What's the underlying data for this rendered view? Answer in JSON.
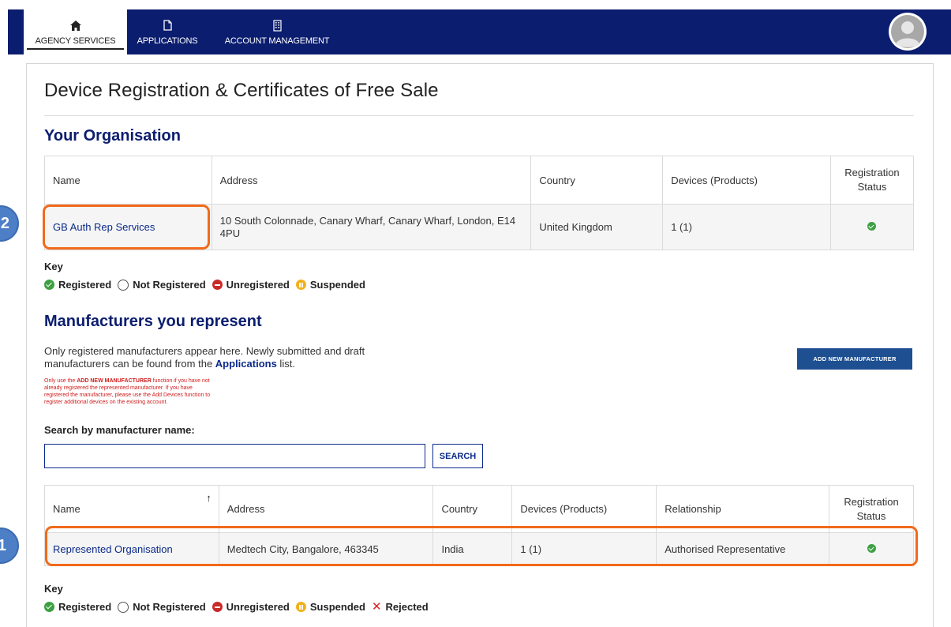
{
  "nav": {
    "tabs": [
      {
        "label": "AGENCY SERVICES",
        "icon": "home-icon",
        "active": true
      },
      {
        "label": "APPLICATIONS",
        "icon": "document-icon",
        "active": false
      },
      {
        "label": "ACCOUNT MANAGEMENT",
        "icon": "building-icon",
        "active": false
      }
    ]
  },
  "page_title": "Device Registration & Certificates of Free Sale",
  "your_org": {
    "heading": "Your Organisation",
    "columns": [
      "Name",
      "Address",
      "Country",
      "Devices (Products)",
      "Registration Status"
    ],
    "row": {
      "name": "GB Auth Rep Services",
      "address": "10 South Colonnade, Canary Wharf, Canary Wharf, London, E14 4PU",
      "country": "United Kingdom",
      "devices": "1 (1)",
      "status": "registered"
    }
  },
  "key1": {
    "title": "Key",
    "items": [
      "Registered",
      "Not Registered",
      "Unregistered",
      "Suspended"
    ]
  },
  "manufacturers": {
    "heading": "Manufacturers you represent",
    "intro_line1": "Only registered manufacturers appear here. Newly submitted and draft",
    "intro_line2_pre": "manufacturers can be found from the ",
    "intro_link": "Applications",
    "intro_line2_post": " list.",
    "warn_pre": "Only use the ",
    "warn_bold": "ADD NEW MANUFACTURER",
    "warn_post1": " function if you have not",
    "warn_line2": "already registered the represented manufacturer. If you have",
    "warn_line3": "registered the manufacturer, please use the Add Devices function to",
    "warn_line4": "register additional devices on the existing account.",
    "add_button": "ADD NEW MANUFACTURER",
    "search_label": "Search by manufacturer name:",
    "search_value": "",
    "search_button": "SEARCH",
    "sort_indicator": "↑",
    "columns": [
      "Name",
      "Address",
      "Country",
      "Devices (Products)",
      "Relationship",
      "Registration Status"
    ],
    "row": {
      "name": "Represented Organisation",
      "address": "Medtech City, Bangalore, 463345",
      "country": "India",
      "devices": "1 (1)",
      "relationship": "Authorised Representative",
      "status": "registered"
    }
  },
  "key2": {
    "title": "Key",
    "items": [
      "Registered",
      "Not Registered",
      "Unregistered",
      "Suspended",
      "Rejected"
    ]
  },
  "annotations": [
    {
      "label": "2",
      "target": "GB Auth Rep Services"
    },
    {
      "label": "1",
      "target": "Represented Organisation row"
    }
  ],
  "colors": {
    "nav_bg": "#0b1d6e",
    "heading": "#0b1d6e",
    "highlight": "#f26a1b",
    "badge": "#4d7fc7",
    "registered": "#3ea043",
    "unregistered": "#c92a2a",
    "suspended": "#f1b11b",
    "rejected": "#dd2222"
  }
}
